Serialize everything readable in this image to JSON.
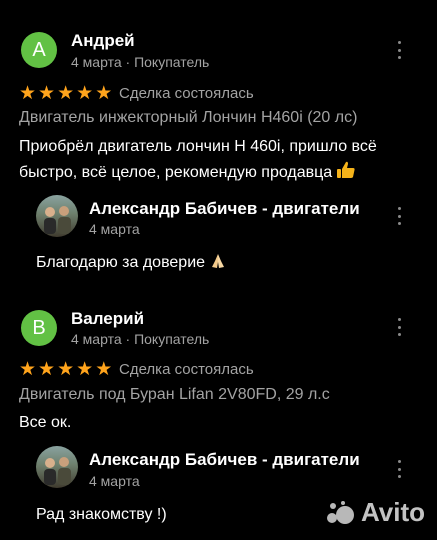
{
  "reviews": [
    {
      "avatar_letter": "A",
      "avatar_color": "#62c144",
      "author": "Андрей",
      "date": "4 марта",
      "separator": "·",
      "role": "Покупатель",
      "rating": 5,
      "status": "Сделка состоялась",
      "product": "Двигатель инжекторный Лончин H460i (20 лс)",
      "text": "Приобрёл двигатель лончин  H 460i, пришло всё быстро, всё целое, рекомендую продавца",
      "text_emoji": "thumbs-up",
      "reply": {
        "author": "Александр Бабичев - двигатели",
        "date": "4 марта",
        "text": "Благодарю за доверие",
        "text_emoji": "folded-hands"
      }
    },
    {
      "avatar_letter": "B",
      "avatar_color": "#62c144",
      "author": "Валерий",
      "date": "4 марта",
      "separator": "·",
      "role": "Покупатель",
      "rating": 5,
      "status": "Сделка состоялась",
      "product": "Двигатель под Буран Lifan 2V80FD, 29 л.с",
      "text": "Все ок.",
      "reply": {
        "author": "Александр Бабичев - двигатели",
        "date": "4 марта",
        "text": "Рад знакомству !)"
      }
    }
  ],
  "colors": {
    "star": "#ffa41c",
    "muted_text": "#a3a3a3"
  },
  "watermark": "Avito"
}
